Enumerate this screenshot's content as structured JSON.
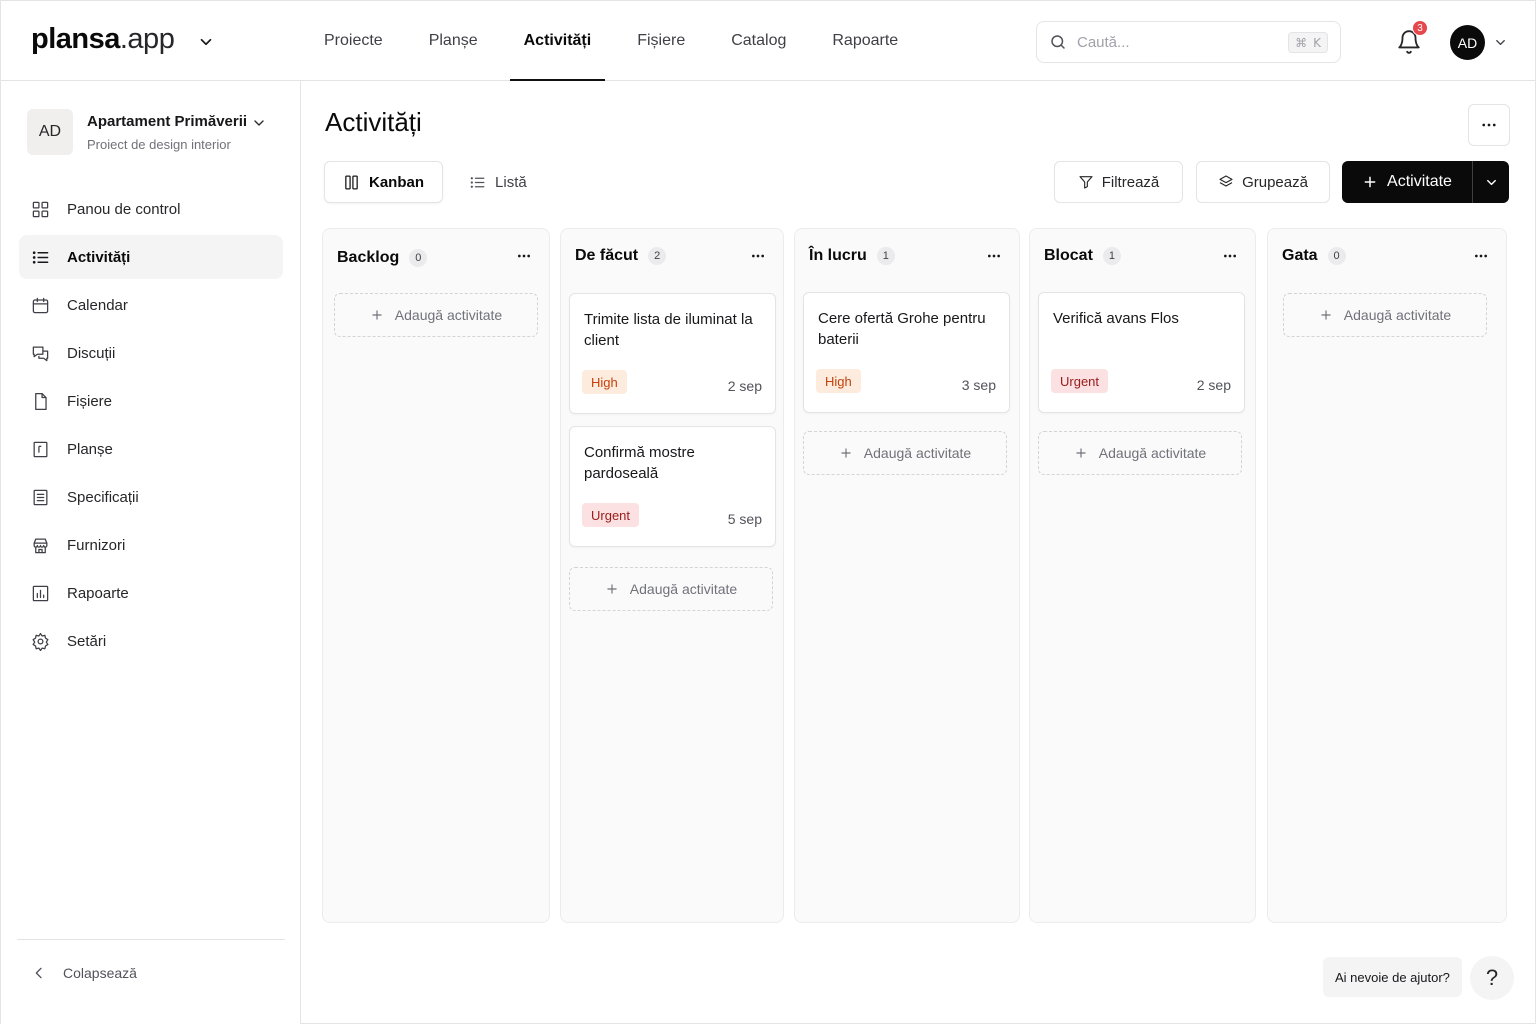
{
  "brand": {
    "name_bold": "plansa",
    "name_light": ".app"
  },
  "nav": [
    {
      "label": "Proiecte",
      "active": false
    },
    {
      "label": "Planșe",
      "active": false
    },
    {
      "label": "Activități",
      "active": true
    },
    {
      "label": "Fișiere",
      "active": false
    },
    {
      "label": "Catalog",
      "active": false
    },
    {
      "label": "Rapoarte",
      "active": false
    }
  ],
  "search": {
    "placeholder": "Caută...",
    "shortcut_mod": "⌘",
    "shortcut_key": "K"
  },
  "notifications": {
    "count": "3",
    "icon": "bell-icon"
  },
  "user": {
    "initials": "AD"
  },
  "project": {
    "initials": "AD",
    "name": "Apartament Primăverii",
    "subtitle": "Proiect de design interior"
  },
  "sidebar": {
    "items": [
      {
        "label": "Panou de control",
        "icon": "grid-icon",
        "active": false
      },
      {
        "label": "Activități",
        "icon": "list-icon",
        "active": true
      },
      {
        "label": "Calendar",
        "icon": "calendar-icon",
        "active": false
      },
      {
        "label": "Discuții",
        "icon": "chat-icon",
        "active": false
      },
      {
        "label": "Fișiere",
        "icon": "file-icon",
        "active": false
      },
      {
        "label": "Planșe",
        "icon": "drawing-icon",
        "active": false
      },
      {
        "label": "Specificații",
        "icon": "spec-icon",
        "active": false
      },
      {
        "label": "Furnizori",
        "icon": "supplier-icon",
        "active": false
      },
      {
        "label": "Rapoarte",
        "icon": "chart-icon",
        "active": false
      },
      {
        "label": "Setări",
        "icon": "gear-icon",
        "active": false
      }
    ],
    "collapse_label": "Colapsează"
  },
  "page": {
    "title": "Activități"
  },
  "views": {
    "kanban": "Kanban",
    "list": "Listă",
    "active": "kanban"
  },
  "toolbar": {
    "filter": "Filtrează",
    "group": "Grupează",
    "add": "Activitate"
  },
  "board": {
    "add_label": "Adaugă activitate",
    "columns": [
      {
        "title": "Backlog",
        "count": "0",
        "cards": []
      },
      {
        "title": "De făcut",
        "count": "2",
        "cards": [
          {
            "title": "Trimite lista de iluminat la client",
            "priority": "High",
            "date": "2 sep"
          },
          {
            "title": "Confirmă mostre pardoseală",
            "priority": "Urgent",
            "date": "5 sep"
          }
        ]
      },
      {
        "title": "În lucru",
        "count": "1",
        "cards": [
          {
            "title": "Cere ofertă Grohe pentru baterii",
            "priority": "High",
            "date": "3 sep"
          }
        ]
      },
      {
        "title": "Blocat",
        "count": "1",
        "cards": [
          {
            "title": "Verifică avans Flos",
            "priority": "Urgent",
            "date": "2 sep"
          }
        ]
      },
      {
        "title": "Gata",
        "count": "0",
        "cards": []
      }
    ]
  },
  "help": {
    "label": "Ai nevoie de ajutor?",
    "icon_text": "?"
  },
  "colors": {
    "accent": "#0a0a0a",
    "high_bg": "#fdecdd",
    "high_fg": "#c2410c",
    "urgent_bg": "#fbe1e1",
    "urgent_fg": "#991b1b",
    "badge": "#e5484d"
  }
}
